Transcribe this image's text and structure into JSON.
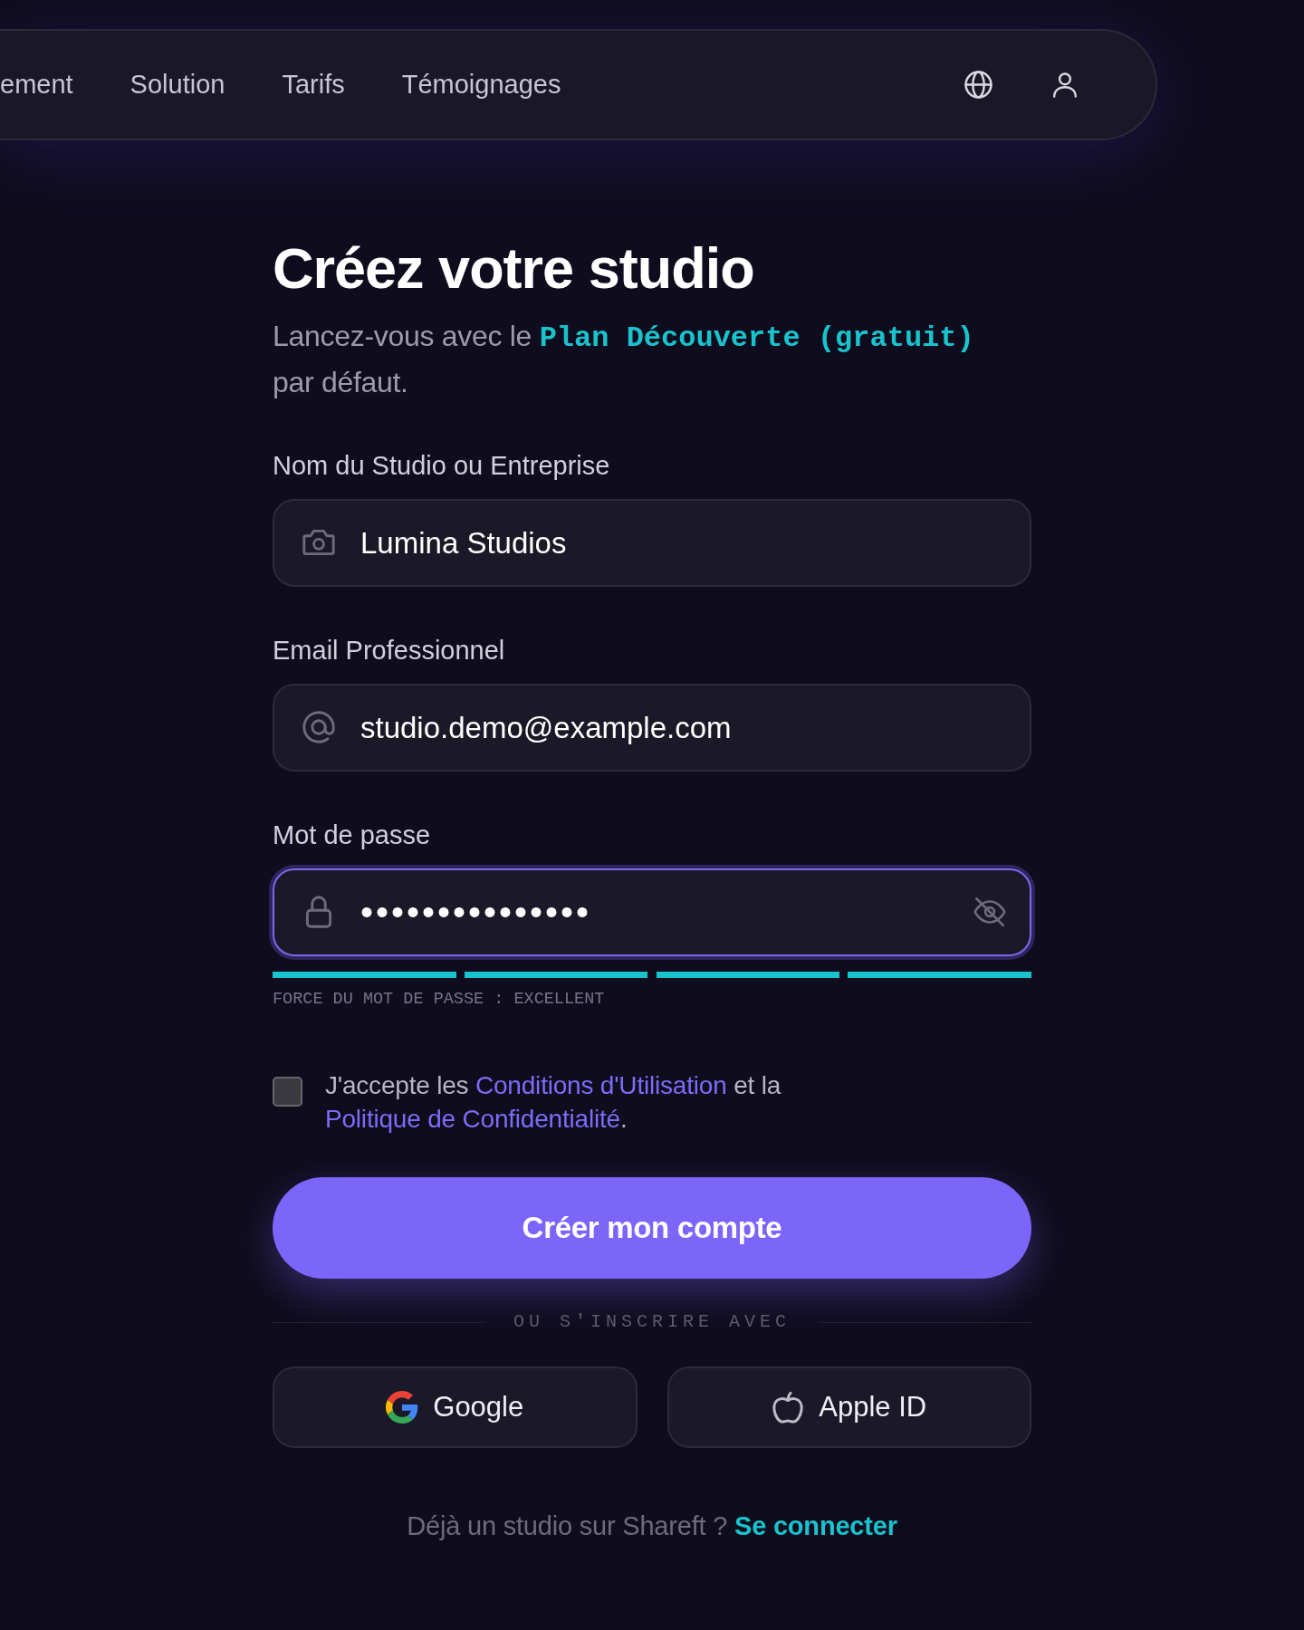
{
  "nav": {
    "links": [
      {
        "label": "ement"
      },
      {
        "label": "Solution"
      },
      {
        "label": "Tarifs"
      },
      {
        "label": "Témoignages"
      }
    ]
  },
  "header": {
    "title": "Créez votre studio",
    "subtitle": [
      {
        "kind": "plain",
        "text": "Lancez-vous avec le "
      },
      {
        "kind": "code",
        "text": "Plan Découverte (gratuit)"
      },
      {
        "kind": "plain",
        "text": " par défaut."
      }
    ]
  },
  "fields": [
    {
      "kind": "text",
      "label": "Nom du Studio ou Entreprise",
      "value": "Lumina Studios",
      "focused": false
    },
    {
      "kind": "email",
      "label": "Email Professionnel",
      "value": "studio.demo@example.com",
      "focused": false
    },
    {
      "kind": "password",
      "label": "Mot de passe",
      "value": "•••••••••••••••",
      "focused": true
    }
  ],
  "password_strength": {
    "level": 1,
    "label": "FORCE DU MOT DE PASSE : EXCELLENT"
  },
  "terms": {
    "checked": false,
    "parts": [
      {
        "kind": "plain",
        "text": "J'accepte les "
      },
      {
        "kind": "link",
        "text": "Conditions d'Utilisation"
      },
      {
        "kind": "plain",
        "text": " et la "
      },
      {
        "kind": "link",
        "text": "Politique de Confidentialité"
      },
      {
        "kind": "plain",
        "text": "."
      }
    ]
  },
  "submit_button": {
    "label": "Créer mon compte"
  },
  "divider": {
    "label": "OU S'INSCRIRE AVEC"
  },
  "social_buttons": [
    {
      "kind": "google",
      "label": "Google"
    },
    {
      "kind": "apple",
      "label": "Apple ID"
    }
  ],
  "signin": {
    "text": "Déjà un studio sur Shareft ? ",
    "link": "Se connecter"
  }
}
